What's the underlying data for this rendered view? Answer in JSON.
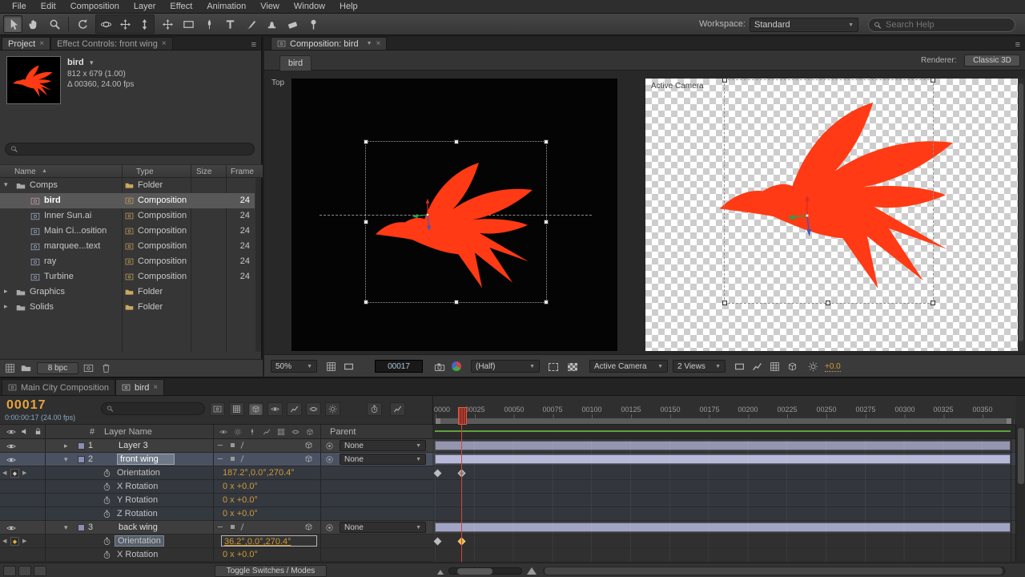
{
  "glyphs": {
    "close": "×",
    "dd": "▼",
    "tri_down": "▾",
    "tri_right": "▸",
    "menu": "≡",
    "sort": "▲",
    "nav_left": "◀",
    "nav_right": "▶",
    "diamond": "◆"
  },
  "menu": {
    "items": [
      "File",
      "Edit",
      "Composition",
      "Layer",
      "Effect",
      "Animation",
      "View",
      "Window",
      "Help"
    ]
  },
  "toolbar": {
    "workspace_label": "Workspace:",
    "workspace_value": "Standard",
    "search_placeholder": "Search Help"
  },
  "project": {
    "tab": "Project",
    "tab_effect_controls": "Effect Controls: front wing",
    "comp_name": "bird",
    "comp_info1": "812 x 679 (1.00)",
    "comp_info2": "Δ 00360, 24.00 fps",
    "col_name": "Name",
    "col_type": "Type",
    "col_size": "Size",
    "col_frame": "Frame",
    "rows": [
      {
        "name": "Comps",
        "type": "Folder",
        "frame": ""
      },
      {
        "name": "bird",
        "type": "Composition",
        "frame": "24"
      },
      {
        "name": "Inner Sun.ai",
        "type": "Composition",
        "frame": "24"
      },
      {
        "name": "Main Ci...osition",
        "type": "Composition",
        "frame": "24"
      },
      {
        "name": "marquee...text",
        "type": "Composition",
        "frame": "24"
      },
      {
        "name": "ray",
        "type": "Composition",
        "frame": "24"
      },
      {
        "name": "Turbine",
        "type": "Composition",
        "frame": "24"
      },
      {
        "name": "Graphics",
        "type": "Folder",
        "frame": ""
      },
      {
        "name": "Solids",
        "type": "Folder",
        "frame": ""
      }
    ],
    "bpc": "8 bpc"
  },
  "comp": {
    "tab": "Composition: bird",
    "sub_tab": "bird",
    "renderer_label": "Renderer:",
    "renderer_value": "Classic 3D",
    "left_view_label": "Top",
    "right_view_label": "Active Camera",
    "zoom": "50%",
    "timecode": "00017",
    "resolution": "(Half)",
    "camera": "Active Camera",
    "views": "2 Views",
    "exposure": "+0.0"
  },
  "timeline": {
    "tab1": "Main City Composition",
    "tab2": "bird",
    "timecode": "00017",
    "timecode_detail": "0:00:00:17 (24.00 fps)",
    "ruler": [
      "0000",
      "00025",
      "00050",
      "00075",
      "00100",
      "00125",
      "00150",
      "00175",
      "00200",
      "00225",
      "00250",
      "00275",
      "00300",
      "00325",
      "00350"
    ],
    "col_number": "#",
    "col_layer_name": "Layer Name",
    "col_parent": "Parent",
    "rows": [
      {
        "kind": "layer",
        "num": "1",
        "name": "Layer 3",
        "parent": "None"
      },
      {
        "kind": "layer",
        "num": "2",
        "name": "front wing",
        "parent": "None"
      },
      {
        "kind": "prop",
        "name": "Orientation",
        "value": "187.2°,0.0°,270.4°"
      },
      {
        "kind": "prop",
        "name": "X Rotation",
        "value": "0 x +0.0°"
      },
      {
        "kind": "prop",
        "name": "Y Rotation",
        "value": "0 x +0.0°"
      },
      {
        "kind": "prop",
        "name": "Z Rotation",
        "value": "0 x +0.0°"
      },
      {
        "kind": "layer",
        "num": "3",
        "name": "back wing",
        "parent": "None"
      },
      {
        "kind": "prop",
        "name": "Orientation",
        "value": "36.2°,0.0°,270.4°"
      },
      {
        "kind": "prop",
        "name": "X Rotation",
        "value": "0 x +0.0°"
      }
    ],
    "toggle_button": "Toggle Switches / Modes"
  }
}
